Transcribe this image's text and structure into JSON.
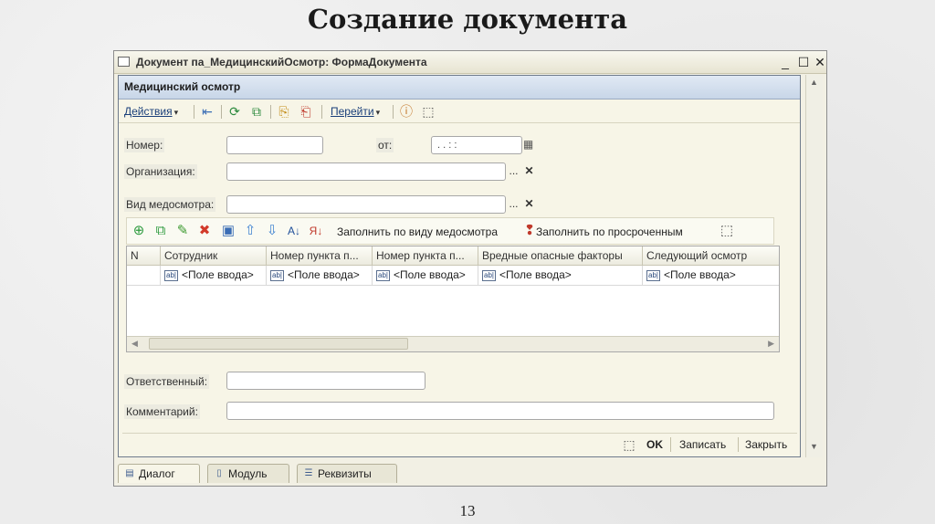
{
  "slide": {
    "title": "Создание документа",
    "page_number": "13"
  },
  "window": {
    "title": "Документ па_МедицинскийОсмотр: ФормаДокумента",
    "controls": {
      "minimize": "_",
      "maximize": "☐",
      "close": "✕"
    }
  },
  "form": {
    "header": "Медицинский осмотр",
    "command_bar": {
      "actions_label": "Действия",
      "goto_label": "Перейти",
      "icons": [
        "save-and-close-icon",
        "refresh-icon",
        "copy-icon",
        "post-icon",
        "unpost-icon",
        "help-icon",
        "customize-icon"
      ]
    },
    "fields": {
      "number_label": "Номер:",
      "number_value": "",
      "date_label": "от:",
      "date_value": " .  .        :  :",
      "organization_label": "Организация:",
      "organization_value": "",
      "exam_type_label": "Вид медосмотра:",
      "exam_type_value": "",
      "responsible_label": "Ответственный:",
      "responsible_value": "",
      "comment_label": "Комментарий:",
      "comment_value": "",
      "select_btn": "...",
      "clear_btn": "✕"
    },
    "grid_toolbar": {
      "fill_by_type": "Заполнить по виду медосмотра",
      "fill_by_overdue": "Заполнить по просроченным"
    },
    "table": {
      "columns": [
        "N",
        "Сотрудник",
        "Номер пункта п...",
        "Номер пункта п...",
        "Вредные опасные факторы",
        "Следующий осмотр"
      ],
      "row": [
        "",
        "<Поле ввода>",
        "<Поле ввода>",
        "<Поле ввода>",
        "<Поле ввода>",
        "<Поле ввода>"
      ],
      "ab_badge": "ab|"
    },
    "footer": {
      "ok": "OK",
      "save": "Записать",
      "close": "Закрыть"
    }
  },
  "tabs": [
    "Диалог",
    "Модуль",
    "Реквизиты"
  ]
}
